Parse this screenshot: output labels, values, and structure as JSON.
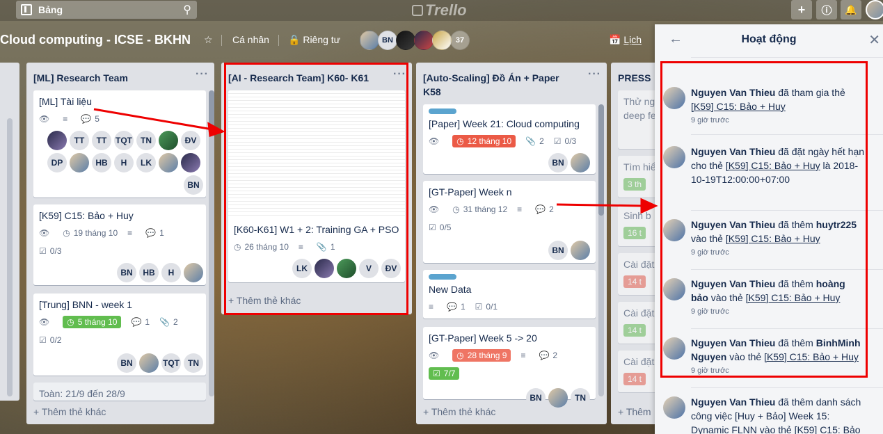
{
  "header": {
    "board_button": "Bảng",
    "logo": "Trello"
  },
  "board": {
    "title": "Cloud computing - ICSE - BKHN",
    "team": "Cá nhân",
    "visibility": "Riêng tư",
    "calendar": "Lịch",
    "members": [
      "BN"
    ],
    "member_count": "37"
  },
  "lists": [
    {
      "title": "[ML] Research Team",
      "cards": [
        {
          "title": "[ML] Tài liệu",
          "comments": "5",
          "members": [
            "TT",
            "TT",
            "TQT",
            "TN",
            "ĐV",
            "DP",
            "HB",
            "H",
            "LK",
            "BN"
          ]
        },
        {
          "title": "[K59] C15: Bảo + Huy",
          "due": "19 tháng 10",
          "comments": "1",
          "checklist": "0/3",
          "members": [
            "BN",
            "HB",
            "H"
          ]
        },
        {
          "title": "[Trung] BNN - week 1",
          "due": "5 tháng 10",
          "comments": "1",
          "attachments": "2",
          "checklist": "0/2",
          "members": [
            "BN",
            "TQT",
            "TN"
          ]
        },
        {
          "title": "Toàn: 21/9 đến 28/9"
        }
      ],
      "add": "Thêm thẻ khác"
    },
    {
      "title": "[AI - Research Team] K60- K61",
      "cards": [
        {
          "title": "[K60-K61] W1 + 2: Training GA + PSO",
          "due": "26 tháng 10",
          "attachments": "1",
          "members": [
            "LK",
            "V",
            "ĐV"
          ]
        }
      ],
      "add": "Thêm thẻ khác"
    },
    {
      "title": "[Auto-Scaling] Đồ Án + Paper K58",
      "cards": [
        {
          "title": "[Paper] Week 21: Cloud computing",
          "due": "12 tháng 10",
          "attachments": "2",
          "checklist": "0/3",
          "members": [
            "BN"
          ]
        },
        {
          "title": "[GT-Paper] Week n",
          "due": "31 tháng 12",
          "comments": "2",
          "checklist": "0/5",
          "members": [
            "BN"
          ]
        },
        {
          "title": "New Data",
          "comments": "1",
          "checklist": "0/1"
        },
        {
          "title": "[GT-Paper] Week 5 -> 20",
          "due": "28 tháng 9",
          "comments": "2",
          "checklist": "7/7",
          "members": [
            "BN",
            "TN"
          ]
        }
      ],
      "add": "Thêm thẻ khác"
    },
    {
      "title": "PRESS",
      "cards": [
        {
          "title": "Thử ng"
        },
        {
          "title": "deep fe"
        },
        {
          "title": "Tìm hiể"
        },
        {
          "title": "3 th"
        },
        {
          "title": "Sinh b"
        },
        {
          "title": "16 t"
        },
        {
          "title": "Cài đặt"
        },
        {
          "title": "14 t"
        },
        {
          "title": "Cài đặt"
        },
        {
          "title": "14 t"
        },
        {
          "title": "Cài đặt"
        },
        {
          "title": "14 t"
        }
      ],
      "add": "Thêm"
    }
  ],
  "activity": {
    "title": "Hoạt động",
    "items": [
      {
        "user": "Nguyen Van Thieu",
        "text": "đã tham gia thẻ",
        "card": "[K59] C15: Bảo + Huy",
        "time": "9 giờ trước"
      },
      {
        "user": "Nguyen Van Thieu",
        "text": "đã đặt ngày hết hạn cho thẻ",
        "card": "[K59] C15: Bảo + Huy",
        "tail": "là 2018-10-19T12:00:00+07:00"
      },
      {
        "user": "Nguyen Van Thieu",
        "text": "đã thêm",
        "target": "huytr225",
        "text2": "vào thẻ",
        "card": "[K59] C15: Bảo + Huy",
        "time": "9 giờ trước"
      },
      {
        "user": "Nguyen Van Thieu",
        "text": "đã thêm",
        "target": "hoàng bảo",
        "text2": "vào thẻ",
        "card": "[K59] C15: Bảo + Huy",
        "time": "9 giờ trước"
      },
      {
        "user": "Nguyen Van Thieu",
        "text": "đã thêm",
        "target": "BinhMinh Nguyen",
        "text2": "vào thẻ",
        "card": "[K59] C15: Bảo + Huy",
        "time": "9 giờ trước"
      },
      {
        "user": "Nguyen Van Thieu",
        "text": "đã thêm danh sách công việc [Huy + Bảo] Week 15: Dynamic FLNN vào thẻ",
        "card": "[K59] C15: Bảo"
      }
    ]
  },
  "colors": {
    "annotation": "#ee0000",
    "due_red": "#eb5a46",
    "due_green": "#61bd4f",
    "label_blue": "#5ba4cf"
  }
}
